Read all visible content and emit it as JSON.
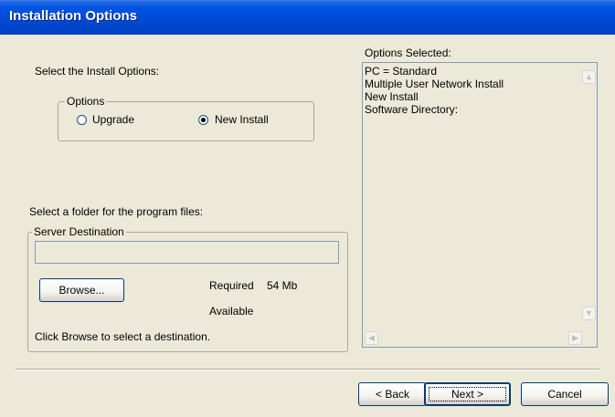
{
  "window": {
    "title": "Installation Options"
  },
  "install_options": {
    "prompt": "Select the Install Options:",
    "group_label": "Options",
    "radios": [
      {
        "label": "Upgrade",
        "checked": false
      },
      {
        "label": "New Install",
        "checked": true
      }
    ]
  },
  "folder": {
    "prompt": "Select a folder for the program files:",
    "group_label": "Server Destination",
    "path_value": "",
    "browse_label": "Browse...",
    "required_label": "Required",
    "required_value": "54 Mb",
    "available_label": "Available",
    "hint": "Click Browse to select a destination."
  },
  "options_selected": {
    "label": "Options Selected:",
    "lines": [
      "PC = Standard",
      "Multiple User Network Install",
      "New Install",
      "Software Directory:"
    ]
  },
  "footer": {
    "back_label": "< Back",
    "next_label": "Next >",
    "cancel_label": "Cancel"
  },
  "colors": {
    "titlebar": "#0054e3",
    "dialog_bg": "#ece9d8",
    "border": "#7f9db9"
  }
}
